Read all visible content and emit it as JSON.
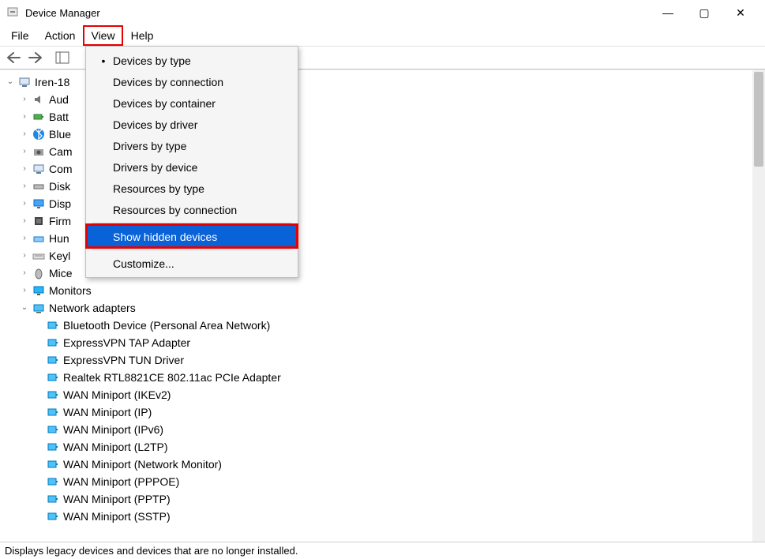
{
  "window": {
    "title": "Device Manager",
    "controls": {
      "minimize": "—",
      "maximize": "▢",
      "close": "✕"
    }
  },
  "menubar": {
    "items": [
      "File",
      "Action",
      "View",
      "Help"
    ],
    "open_index": 2
  },
  "toolbar": {
    "back": "←",
    "forward": "→"
  },
  "dropdown": {
    "items": [
      {
        "label": "Devices by type",
        "checked": true
      },
      {
        "label": "Devices by connection"
      },
      {
        "label": "Devices by container"
      },
      {
        "label": "Devices by driver"
      },
      {
        "label": "Drivers by type"
      },
      {
        "label": "Drivers by device"
      },
      {
        "label": "Resources by type"
      },
      {
        "label": "Resources by connection"
      },
      {
        "label": "Show hidden devices",
        "selected": true,
        "framed": true
      },
      {
        "label": "Customize..."
      }
    ],
    "separator_before": [
      8,
      9
    ]
  },
  "tree": {
    "root": {
      "label": "Iren-18",
      "expanded": true
    },
    "categories": [
      {
        "label": "Aud",
        "icon": "speaker"
      },
      {
        "label": "Batt",
        "icon": "battery"
      },
      {
        "label": "Blue",
        "icon": "bluetooth"
      },
      {
        "label": "Cam",
        "icon": "camera"
      },
      {
        "label": "Com",
        "icon": "computer"
      },
      {
        "label": "Disk",
        "icon": "disk"
      },
      {
        "label": "Disp",
        "icon": "display"
      },
      {
        "label": "Firm",
        "icon": "firmware"
      },
      {
        "label": "Hun",
        "icon": "hid"
      },
      {
        "label": "Keyl",
        "icon": "keyboard"
      },
      {
        "label": "Mice",
        "icon": "mouse"
      },
      {
        "label": "Monitors",
        "icon": "monitor",
        "full": true
      },
      {
        "label": "Network adapters",
        "icon": "network",
        "full": true,
        "expanded": true
      }
    ],
    "network_children": [
      "Bluetooth Device (Personal Area Network)",
      "ExpressVPN TAP Adapter",
      "ExpressVPN TUN Driver",
      "Realtek RTL8821CE 802.11ac PCIe Adapter",
      "WAN Miniport (IKEv2)",
      "WAN Miniport (IP)",
      "WAN Miniport (IPv6)",
      "WAN Miniport (L2TP)",
      "WAN Miniport (Network Monitor)",
      "WAN Miniport (PPPOE)",
      "WAN Miniport (PPTP)",
      "WAN Miniport (SSTP)"
    ]
  },
  "statusbar": {
    "text": "Displays legacy devices and devices that are no longer installed."
  }
}
